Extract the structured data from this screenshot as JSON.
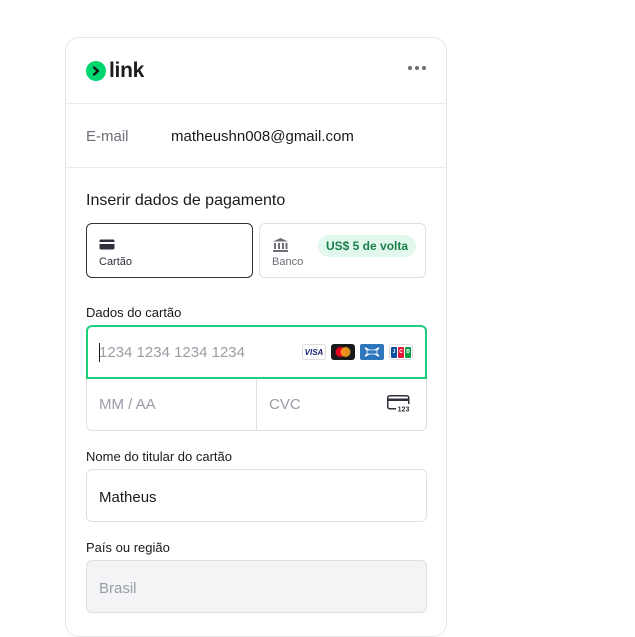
{
  "brand": {
    "name": "link",
    "accent": "#00d66f"
  },
  "header": {
    "menu_icon": "more-horizontal-icon"
  },
  "account": {
    "email_label": "E-mail",
    "email_value": "matheushn008@gmail.com"
  },
  "payment": {
    "title": "Inserir dados de pagamento",
    "methods": [
      {
        "label": "Cartão",
        "icon": "credit-card-icon",
        "selected": true
      },
      {
        "label": "Banco",
        "icon": "bank-icon",
        "badge": "US$ 5 de volta",
        "selected": false
      }
    ]
  },
  "card_details": {
    "label": "Dados do cartão",
    "number_placeholder": "1234 1234 1234 1234",
    "brands": [
      "VISA",
      "mastercard",
      "amex",
      "JCB"
    ],
    "expiry_placeholder": "MM / AA",
    "cvc_placeholder": "CVC",
    "cvc_icon_text": "123"
  },
  "cardholder": {
    "label": "Nome do titular do cartão",
    "value": "Matheus"
  },
  "country": {
    "label": "País ou região",
    "value": "Brasil"
  }
}
